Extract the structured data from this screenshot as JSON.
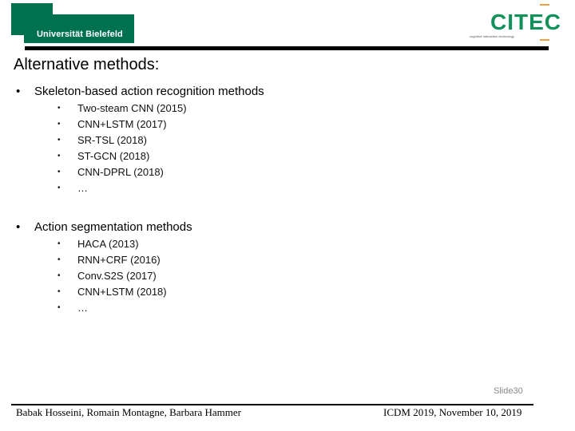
{
  "header": {
    "university_logo": "Universität Bielefeld",
    "citec_logo": "CITEC",
    "citec_tagline": "cognitive interaction technology"
  },
  "title": "Alternative methods:",
  "sections": [
    {
      "label": "Skeleton-based action recognition methods",
      "items": [
        "Two-steam CNN (2015)",
        "CNN+LSTM (2017)",
        "SR-TSL (2018)",
        "ST-GCN (2018)",
        "CNN-DPRL (2018)",
        "…"
      ]
    },
    {
      "label": "Action segmentation methods",
      "items": [
        "HACA (2013)",
        "RNN+CRF (2016)",
        "Conv.S2S (2017)",
        "CNN+LSTM (2018)",
        "…"
      ]
    }
  ],
  "bullet": "•",
  "footer": {
    "slide": "Slide30",
    "authors": "Babak Hosseini, Romain Montagne, Barbara Hammer",
    "venue": "ICDM 2019, November 10, 2019"
  }
}
